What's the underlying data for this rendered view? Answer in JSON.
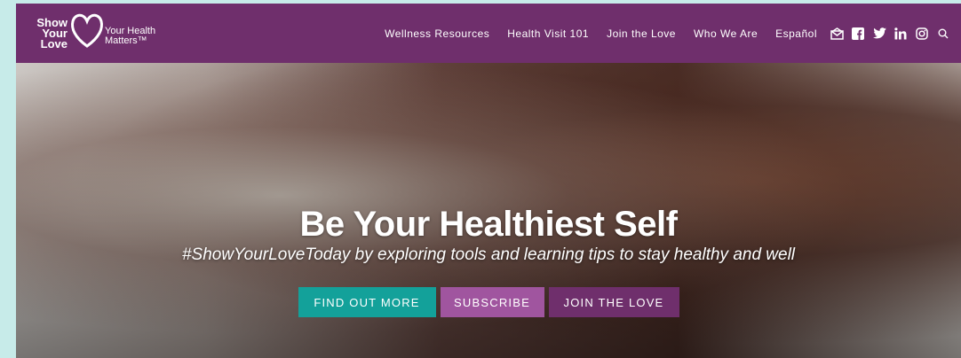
{
  "brand": {
    "logo_line1": "Show",
    "logo_line2": "Your",
    "logo_line3": "Love",
    "tagline_line1": "Your Health",
    "tagline_line2": "Matters™"
  },
  "nav": {
    "items": [
      {
        "label": "Wellness Resources"
      },
      {
        "label": "Health Visit 101"
      },
      {
        "label": "Join the Love"
      },
      {
        "label": "Who We Are"
      },
      {
        "label": "Español"
      }
    ],
    "social_icons": [
      "email-icon",
      "facebook-icon",
      "twitter-icon",
      "linkedin-icon",
      "instagram-icon",
      "search-icon"
    ]
  },
  "hero": {
    "title": "Be Your Healthiest Self",
    "subtitle": "#ShowYourLoveToday by exploring tools and learning tips to stay healthy and well",
    "buttons": {
      "find_out_more": "FIND OUT MORE",
      "subscribe": "SUBSCRIBE",
      "join_the_love": "JOIN THE LOVE"
    }
  },
  "colors": {
    "header_bg": "#6f2f6c",
    "teal": "#13a19a",
    "purple": "#a0559f",
    "dark_purple": "#6f2f6c",
    "page_bg": "#c7ebe9"
  }
}
